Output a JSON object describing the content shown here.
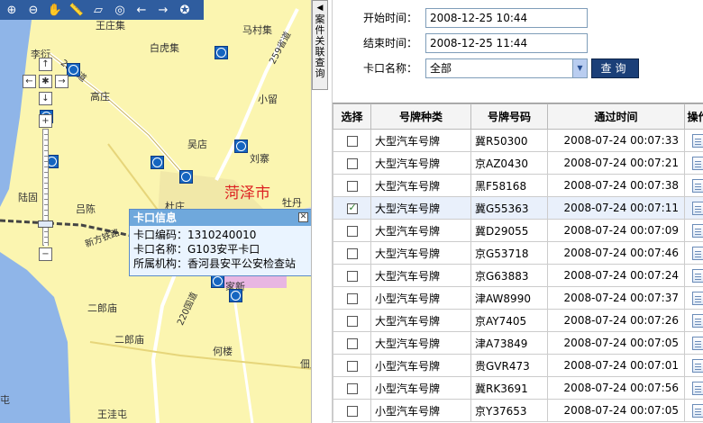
{
  "map": {
    "toolbar_icons": [
      "zoom-in-icon",
      "zoom-out-icon",
      "pan-hand-icon",
      "measure-icon",
      "eraser-icon",
      "globe-icon",
      "back-arrow-icon",
      "forward-arrow-icon",
      "star-badge-icon"
    ],
    "places": {
      "wanggu": "王庄集",
      "bhj": "白虎集",
      "majij": "马村集",
      "dadian": "大店",
      "gaozhuang": "高庄",
      "xiaoliu": "小留",
      "wudian": "吴店",
      "liuzhai": "刘寨",
      "lugu": "陆固",
      "lvdian": "吕陈",
      "duzhuang": "杜庄",
      "mudan": "牡丹",
      "yi": "黄",
      "erlangmiao1": "二郎庙",
      "erlangmiao2": "二郎庙",
      "heilou": "何楼",
      "wangjietun": "王洼屯",
      "tun": "屯",
      "jiaxiang": "家新",
      "baitong": "佃户",
      "city": "菏泽市",
      "gan": "甘",
      "xinfang": "新方铁路",
      "lijia": "李衍"
    },
    "road_labels": [
      "28国道",
      "259省道",
      "220国道",
      "220国道"
    ],
    "popup": {
      "title": "卡口信息",
      "code": "卡口编码：1310240010",
      "name": "卡口名称：G103安平卡口",
      "org": "所属机构：香河县安平公安检查站"
    },
    "side_tab": "案件关联查询"
  },
  "form": {
    "start_label": "开始时间：",
    "start_value": "2008-12-25 10:44",
    "end_label": "结束时间：",
    "end_value": "2008-12-25 11:44",
    "gate_label": "卡口名称：",
    "gate_value": "全部",
    "query_button": "查询"
  },
  "table": {
    "headers": [
      "选择",
      "号牌种类",
      "号牌号码",
      "通过时间",
      "操作"
    ],
    "rows": [
      {
        "checked": false,
        "type": "大型汽车号牌",
        "plate": "冀R50300",
        "time": "2008-07-24 00:07:33"
      },
      {
        "checked": false,
        "type": "大型汽车号牌",
        "plate": "京AZ0430",
        "time": "2008-07-24 00:07:21"
      },
      {
        "checked": false,
        "type": "大型汽车号牌",
        "plate": "黑F58168",
        "time": "2008-07-24 00:07:38"
      },
      {
        "checked": true,
        "type": "大型汽车号牌",
        "plate": "冀G55363",
        "time": "2008-07-24 00:07:11"
      },
      {
        "checked": false,
        "type": "大型汽车号牌",
        "plate": "冀D29055",
        "time": "2008-07-24 00:07:09"
      },
      {
        "checked": false,
        "type": "大型汽车号牌",
        "plate": "京G53718",
        "time": "2008-07-24 00:07:46"
      },
      {
        "checked": false,
        "type": "大型汽车号牌",
        "plate": "京G63883",
        "time": "2008-07-24 00:07:24"
      },
      {
        "checked": false,
        "type": "小型汽车号牌",
        "plate": "津AW8990",
        "time": "2008-07-24 00:07:37"
      },
      {
        "checked": false,
        "type": "大型汽车号牌",
        "plate": "京AY7405",
        "time": "2008-07-24 00:07:26"
      },
      {
        "checked": false,
        "type": "大型汽车号牌",
        "plate": "津A73849",
        "time": "2008-07-24 00:07:05"
      },
      {
        "checked": false,
        "type": "小型汽车号牌",
        "plate": "贵GVR473",
        "time": "2008-07-24 00:07:01"
      },
      {
        "checked": false,
        "type": "小型汽车号牌",
        "plate": "冀RK3691",
        "time": "2008-07-24 00:07:56"
      },
      {
        "checked": false,
        "type": "小型汽车号牌",
        "plate": "京Y37653",
        "time": "2008-07-24 00:07:05"
      }
    ]
  }
}
